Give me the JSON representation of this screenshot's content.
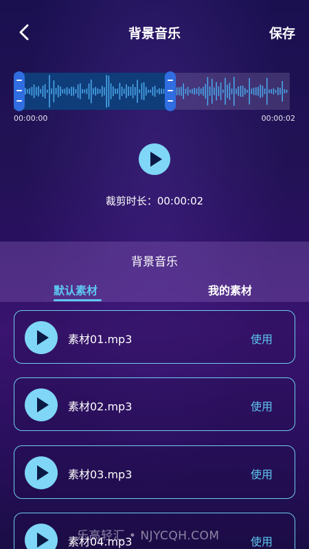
{
  "header": {
    "title": "背景音乐",
    "save_label": "保存"
  },
  "waveform": {
    "start_time": "00:00:00",
    "end_time": "00:00:02",
    "selected_fraction": 0.55,
    "colors": {
      "selected_bg": "#0f3d7a",
      "bars": "#4aa6ea",
      "handle": "#2f6de0"
    }
  },
  "clip": {
    "label": "裁剪时长：",
    "value": "00:00:02"
  },
  "panel": {
    "title": "背景音乐",
    "tabs": [
      {
        "label": "默认素材",
        "active": true
      },
      {
        "label": "我的素材",
        "active": false
      }
    ]
  },
  "materials": [
    {
      "name": "素材01.mp3",
      "action": "使用"
    },
    {
      "name": "素材02.mp3",
      "action": "使用"
    },
    {
      "name": "素材03.mp3",
      "action": "使用"
    },
    {
      "name": "素材04.mp3",
      "action": "使用"
    }
  ],
  "watermark": "乐高轻汇 • NJYCQH.COM",
  "colors": {
    "accent": "#5ec8f2",
    "play_button": "#7fd6f7"
  }
}
